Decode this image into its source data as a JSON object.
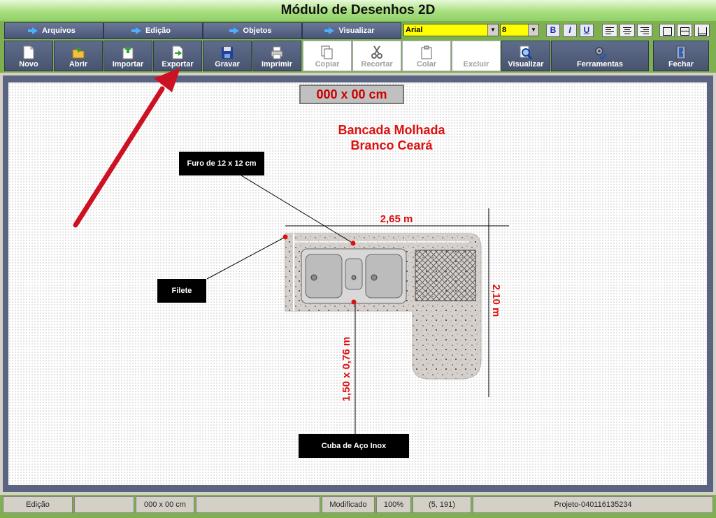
{
  "window": {
    "title": "Módulo de Desenhos 2D"
  },
  "menu": [
    {
      "label": "Arquivos"
    },
    {
      "label": "Edição"
    },
    {
      "label": "Objetos"
    },
    {
      "label": "Visualizar"
    }
  ],
  "format": {
    "font": "Arial",
    "size": "8",
    "bold": "B",
    "italic": "I",
    "underline": "U"
  },
  "toolbar": [
    {
      "label": "Novo",
      "icon": "new-file-icon"
    },
    {
      "label": "Abrir",
      "icon": "open-folder-icon"
    },
    {
      "label": "Importar",
      "icon": "import-icon"
    },
    {
      "label": "Exportar",
      "icon": "export-icon"
    },
    {
      "label": "Gravar",
      "icon": "save-disk-icon"
    },
    {
      "label": "Imprimir",
      "icon": "printer-icon"
    },
    {
      "label": "Copiar",
      "icon": "copy-icon",
      "disabled": true
    },
    {
      "label": "Recortar",
      "icon": "scissors-icon",
      "disabled": true
    },
    {
      "label": "Colar",
      "icon": "paste-icon",
      "disabled": true
    },
    {
      "label": "Excluir",
      "icon": "delete-icon",
      "disabled": true
    },
    {
      "label": "Visualizar",
      "icon": "magnifier-icon"
    },
    {
      "label": "Ferramentas",
      "icon": "tools-icon"
    },
    {
      "label": "Fechar",
      "icon": "exit-door-icon"
    }
  ],
  "drawing": {
    "dimension_box": "000 x 00 cm",
    "title_line1": "Bancada Molhada",
    "title_line2": "Branco Ceará",
    "width_label": "2,65 m",
    "height_label": "2,10 m",
    "sink_dim_label": "1,50 x 0,76 m",
    "callouts": {
      "hole": "Furo de 12 x 12 cm",
      "edge": "Filete",
      "sink": "Cuba de Aço Inox"
    }
  },
  "status": {
    "mode": "Edição",
    "empty1": "",
    "dimensions": "000 x 00 cm",
    "empty2": "",
    "state": "Modificado",
    "zoom": "100%",
    "coords": "(5, 191)",
    "project": "Projeto-040116135234"
  },
  "colors": {
    "accent_green": "#7fb050",
    "title_red": "#dd1010",
    "annotation_arrow": "#cc1122"
  }
}
